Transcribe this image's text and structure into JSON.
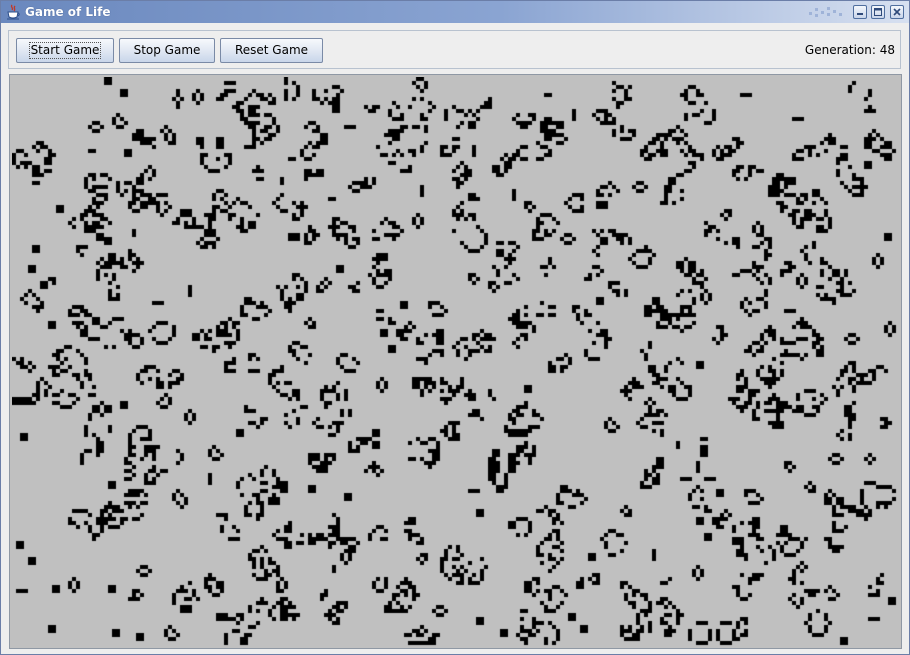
{
  "window": {
    "title": "Game of Life",
    "app_icon": "java-cup-icon",
    "controls": [
      "minimize-icon",
      "maximize-icon",
      "close-icon"
    ]
  },
  "toolbar": {
    "start_label": "Start Game",
    "stop_label": "Stop Game",
    "reset_label": "Reset Game",
    "generation_text": "Generation: 48"
  },
  "grid": {
    "live_cell_color": "#000000",
    "dead_cell_color": "#c0c0c0"
  },
  "colors": {
    "titlebar_start": "#6a88be",
    "titlebar_end": "#d7e0f0",
    "panel_background": "#eeeeee"
  }
}
